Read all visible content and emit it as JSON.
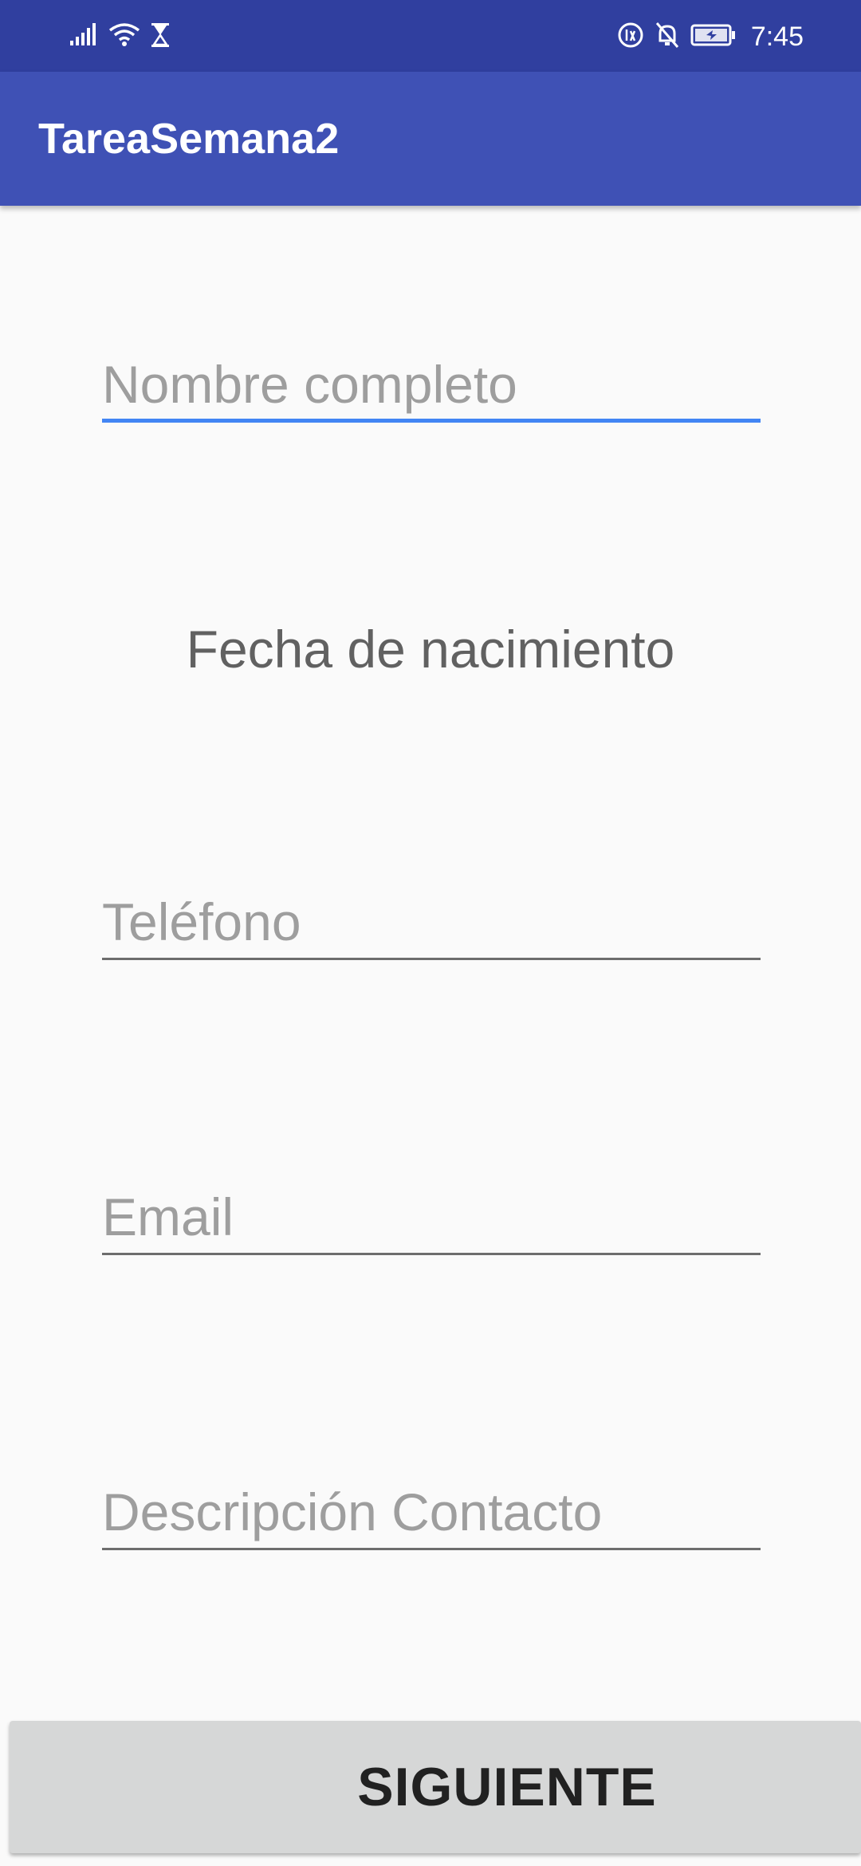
{
  "status_bar": {
    "time": "7:45",
    "icons": [
      "signal-icon",
      "wifi-icon",
      "hourglass-icon",
      "data-saver-icon",
      "bell-off-icon",
      "battery-charging-icon"
    ]
  },
  "app_bar": {
    "title": "TareaSemana2"
  },
  "form": {
    "name_field": {
      "placeholder": "Nombre completo",
      "value": ""
    },
    "birth_date_label": "Fecha de nacimiento",
    "phone_field": {
      "placeholder": "Teléfono",
      "value": ""
    },
    "email_field": {
      "placeholder": "Email",
      "value": ""
    },
    "description_field": {
      "placeholder": "Descripción Contacto",
      "value": ""
    }
  },
  "actions": {
    "next_label": "SIGUIENTE"
  },
  "colors": {
    "status_bar": "#303f9f",
    "app_bar": "#3f51b5",
    "focus_accent": "#4285f4",
    "background": "#fafafa",
    "button": "#d6d7d7"
  }
}
